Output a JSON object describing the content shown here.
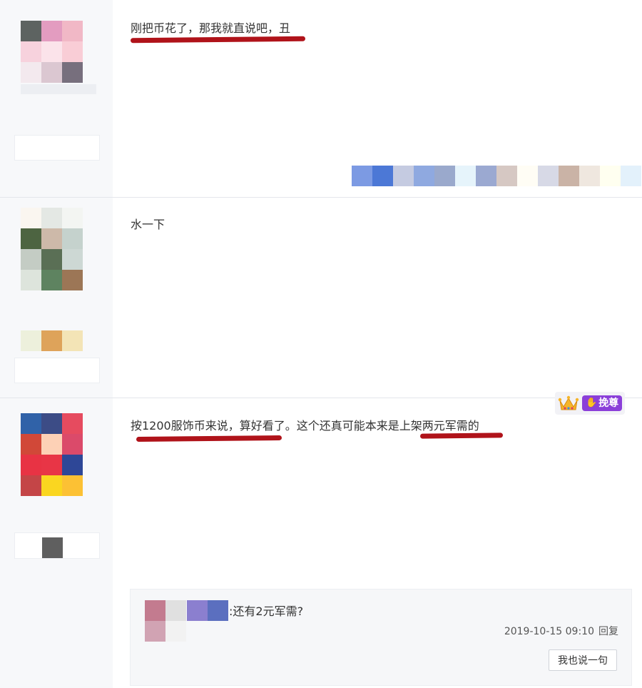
{
  "posts": [
    {
      "content": "刚把币花了，那我就直说吧，丑",
      "avatar_colors": [
        "#5d6361",
        "#e39cc0",
        "#f1b8c6",
        "#f7d2dd",
        "#fbe3ea",
        "#f9cdd6",
        "#f3e9ee",
        "#dbc7d1",
        "#776f7d"
      ],
      "signature_colors": [
        "#7c9ae3",
        "#4c78d6",
        "#c5cbe1",
        "#8fa9e0",
        "#9aa9cc",
        "#e6f4fb",
        "#9ba9d1",
        "#d6c8c3",
        "#fffdf5",
        "#d7d9e6",
        "#cab3a6",
        "#efe7df",
        "#fffff0",
        "#e3f1fb"
      ]
    },
    {
      "content": "水一下",
      "avatar_colors": [
        "#faf6f0",
        "#e4e8e4",
        "#f3f5f2",
        "#4d6441",
        "#cdb9a9",
        "#c5d2cd",
        "#c4ccc4",
        "#5a6f55",
        "#cdd8d4",
        "#dde4dc",
        "#5e8360",
        "#9c7656"
      ],
      "extra_colors": [
        "#edf0dc",
        "#dea35a",
        "#f3e4b6"
      ]
    },
    {
      "content_parts": [
        "按1200服饰币来说，算好看了。这个还真可能本来是",
        "上架两元军需的"
      ],
      "avatar_colors": [
        "#3062a8",
        "#3c4c86",
        "#e64b5f",
        "#d14838",
        "#fdd1b6",
        "#db4a6a",
        "#e83344",
        "#e83546",
        "#2e4797",
        "#c44547",
        "#fad620",
        "#fcc134"
      ],
      "name_color": "#5f5f5f",
      "badge_label": "挽尊",
      "reply": {
        "avatar_colors": [
          "#c37b8f",
          "#e0e0e0",
          "#d1a3b3",
          "#f2f2f2"
        ],
        "name_colors": [
          "#8b7fcf",
          "#5b6fbf"
        ],
        "text_suffix": ":还有2元军需?",
        "timestamp": "2019-10-15 09:10",
        "reply_label": "回复",
        "button_label": "我也说一句"
      }
    }
  ],
  "underline_color": "#b0131a"
}
